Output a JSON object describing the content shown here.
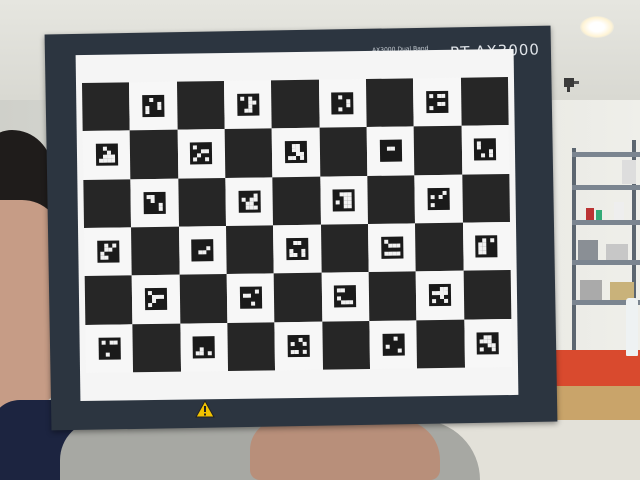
{
  "scene": {
    "description_free": true,
    "box": {
      "brand_text": "RT-AX3000",
      "subtitle_text": "AX3000 Dual Band"
    },
    "calibration_board": {
      "pattern": "charuco",
      "columns": 9,
      "rows": 6,
      "first_cell_dark": true
    }
  },
  "colors": {
    "box": "#2c3540",
    "board_dark": "#262626",
    "board_light": "#f7f7f7",
    "table_red": "#d94a2e",
    "warning_yellow": "#f2c300"
  },
  "icons": {
    "warning": "warning-triangle-icon",
    "alarm": "fire-alarm-icon"
  }
}
